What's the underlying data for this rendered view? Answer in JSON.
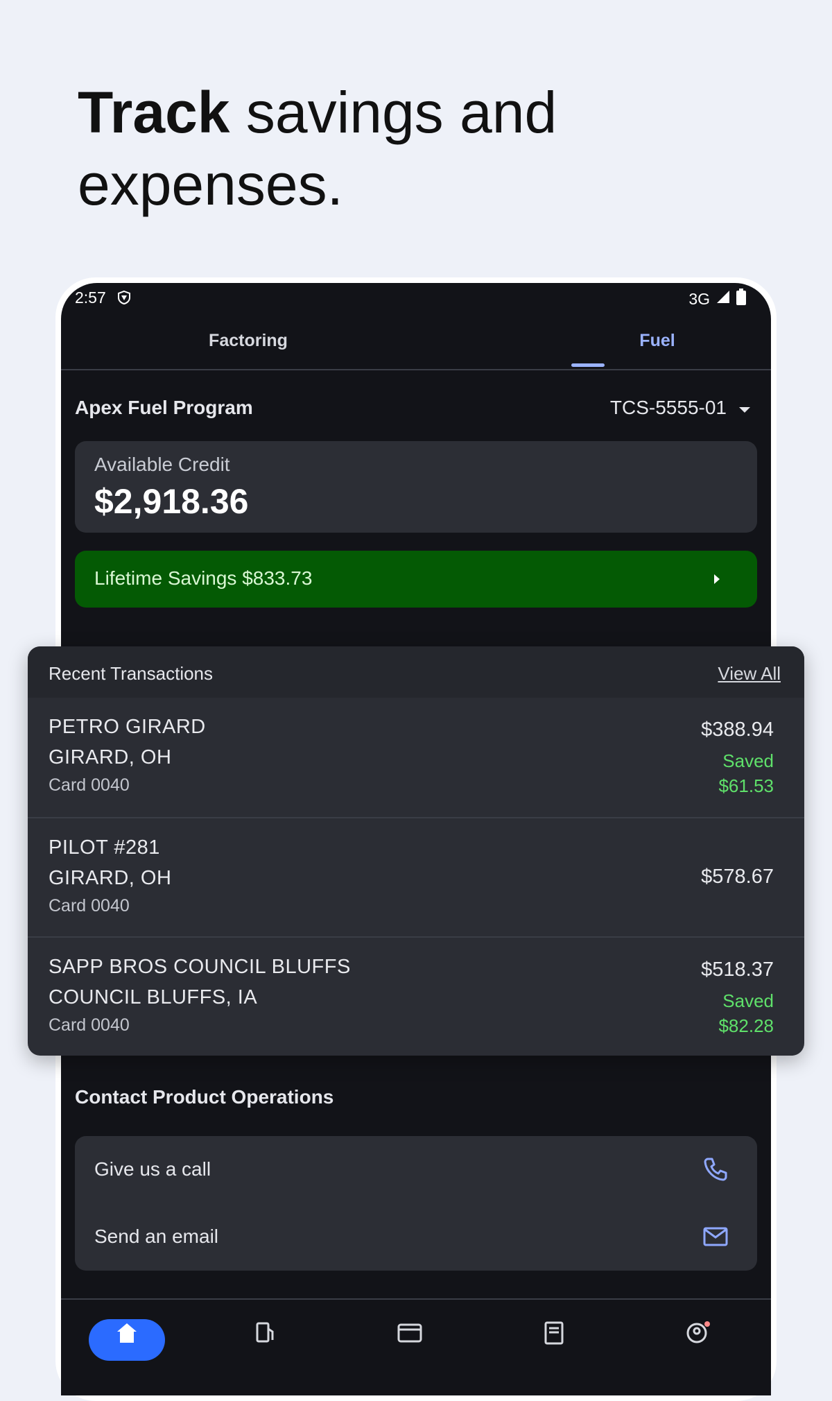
{
  "headline": {
    "bold": "Track",
    "rest": " savings and expenses."
  },
  "status_bar": {
    "time": "2:57",
    "network": "3G"
  },
  "tabs": [
    {
      "label": "Factoring",
      "active": false
    },
    {
      "label": "Fuel",
      "active": true
    }
  ],
  "program": {
    "name": "Apex Fuel Program",
    "account": "TCS-5555-01"
  },
  "credit": {
    "label": "Available Credit",
    "value": "$2,918.36"
  },
  "savings": {
    "label": "Lifetime Savings $833.73"
  },
  "transactions": {
    "title": "Recent Transactions",
    "view_all": "View All",
    "items": [
      {
        "merchant": "PETRO GIRARD",
        "location": "GIRARD, OH",
        "card": "Card 0040",
        "amount": "$388.94",
        "saved_label": "Saved",
        "saved_value": "$61.53"
      },
      {
        "merchant": "PILOT #281",
        "location": "GIRARD, OH",
        "card": "Card 0040",
        "amount": "$578.67"
      },
      {
        "merchant": "SAPP BROS COUNCIL BLUFFS",
        "location": "COUNCIL BLUFFS, IA",
        "card": "Card 0040",
        "amount": "$518.37",
        "saved_label": "Saved",
        "saved_value": "$82.28"
      }
    ]
  },
  "contact": {
    "title": "Contact Product Operations",
    "call_label": "Give us a call",
    "email_label": "Send an email"
  },
  "colors": {
    "background": "#eef1f8",
    "screen": "#121318",
    "card": "#2c2e35",
    "accent": "#9bb3ff",
    "savings_green": "#045a04",
    "saved_text": "#5fe06a",
    "nav_active": "#2b6bff"
  },
  "icons": [
    "shield-icon",
    "signal-icon",
    "battery-icon",
    "dropdown-arrow-icon",
    "chevron-right-icon",
    "phone-icon",
    "mail-icon",
    "home-icon",
    "fuel-pump-icon",
    "card-icon",
    "document-icon",
    "profile-icon"
  ]
}
